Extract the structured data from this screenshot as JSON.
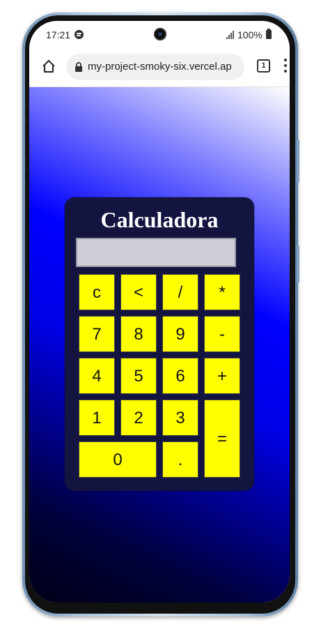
{
  "status": {
    "time": "17:21",
    "battery": "100%"
  },
  "browser": {
    "url": "my-project-smoky-six.vercel.ap",
    "tab_count": "1"
  },
  "calculator": {
    "title": "Calculadora",
    "display": "",
    "keys": {
      "clear": "c",
      "backspace": "<",
      "divide": "/",
      "multiply": "*",
      "seven": "7",
      "eight": "8",
      "nine": "9",
      "minus": "-",
      "four": "4",
      "five": "5",
      "six": "6",
      "plus": "+",
      "one": "1",
      "two": "2",
      "three": "3",
      "equals": "=",
      "zero": "0",
      "decimal": "."
    }
  },
  "colors": {
    "key_bg": "#ffff00",
    "calc_bg": "#131440",
    "display_bg": "#cdcdd6"
  },
  "icons": [
    "spotify-icon",
    "camera-icon",
    "signal-icon",
    "battery-icon",
    "home-icon",
    "lock-icon",
    "tabs-icon",
    "menu-icon"
  ]
}
